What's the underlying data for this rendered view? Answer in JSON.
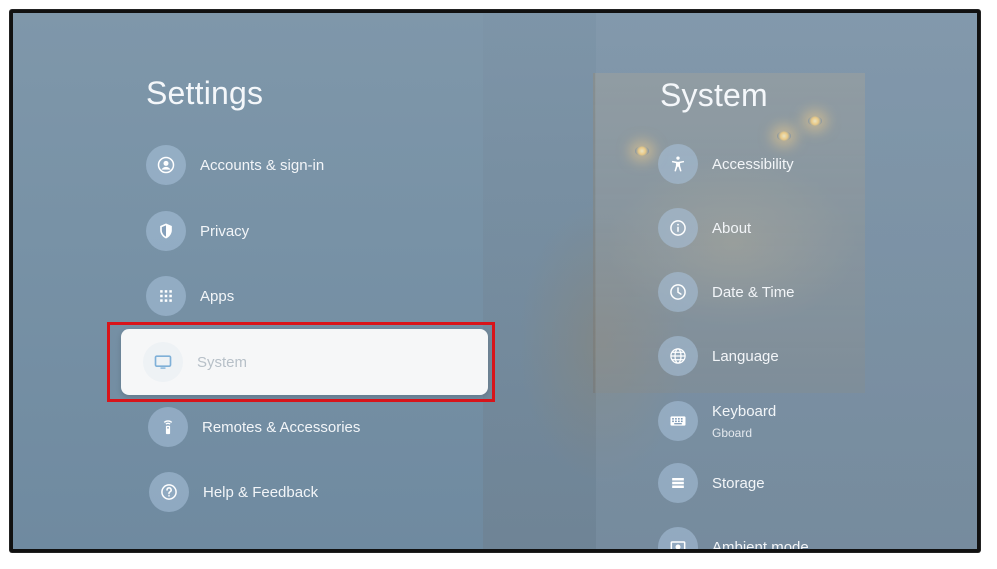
{
  "settings": {
    "title": "Settings",
    "items": [
      {
        "label": "Accounts & sign-in",
        "icon": "account-icon"
      },
      {
        "label": "Privacy",
        "icon": "shield-icon"
      },
      {
        "label": "Apps",
        "icon": "apps-grid-icon"
      },
      {
        "label": "System",
        "icon": "tv-icon"
      },
      {
        "label": "Remotes & Accessories",
        "icon": "remote-icon"
      },
      {
        "label": "Help & Feedback",
        "icon": "help-icon"
      }
    ],
    "selected": "System"
  },
  "system": {
    "title": "System",
    "items": [
      {
        "label": "Accessibility",
        "icon": "accessibility-icon"
      },
      {
        "label": "About",
        "icon": "info-icon"
      },
      {
        "label": "Date & Time",
        "icon": "clock-icon"
      },
      {
        "label": "Language",
        "icon": "globe-icon"
      },
      {
        "label": "Keyboard",
        "sublabel": "Gboard",
        "icon": "keyboard-icon"
      },
      {
        "label": "Storage",
        "icon": "storage-icon"
      },
      {
        "label": "Ambient mode",
        "icon": "ambient-mode-icon"
      }
    ]
  },
  "colors": {
    "highlight": "#d8141a",
    "selected_card": "#f6f7f8",
    "icon_circle": "#aac3dc"
  }
}
